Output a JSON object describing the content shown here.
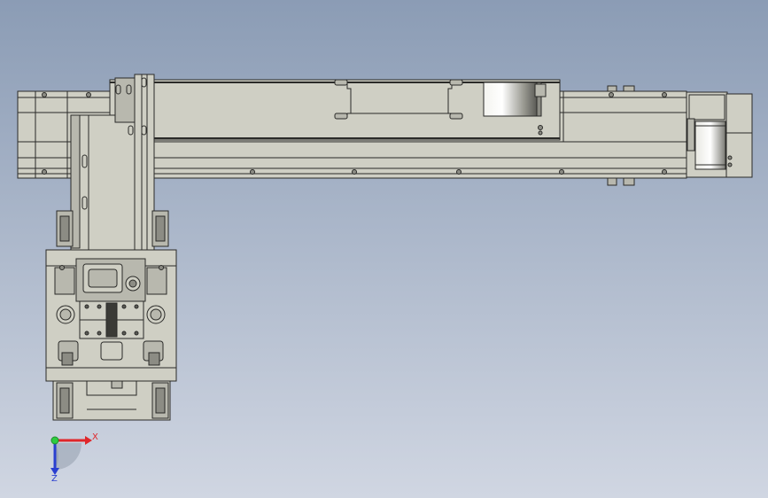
{
  "colors": {
    "bg_top": "#8b9cb5",
    "bg_bottom": "#d0d6e2",
    "metal": "#cfcfc4",
    "metal_dark": "#b8b8ae",
    "line": "#2a2a28",
    "axis_x": "#e0262a",
    "axis_y": "#2a3fd0",
    "axis_z": "#2a3fd0",
    "origin": "#2ecc40"
  },
  "triad": {
    "x_label": "X",
    "z_label": "Z"
  }
}
